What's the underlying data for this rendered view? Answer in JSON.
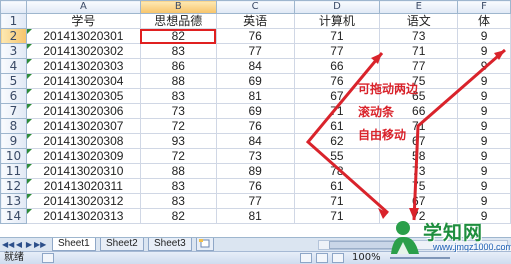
{
  "columns": [
    "A",
    "B",
    "C",
    "D",
    "E",
    "F"
  ],
  "header_row": {
    "row_number": "1",
    "cells": [
      "学号",
      "思想品德",
      "英语",
      "计算机",
      "语文",
      "体"
    ]
  },
  "rows": [
    {
      "num": "2",
      "cells": [
        "201413020301",
        "82",
        "76",
        "71",
        "73",
        "9"
      ]
    },
    {
      "num": "3",
      "cells": [
        "201413020302",
        "83",
        "77",
        "77",
        "71",
        "9"
      ]
    },
    {
      "num": "4",
      "cells": [
        "201413020303",
        "86",
        "84",
        "66",
        "77",
        "9"
      ]
    },
    {
      "num": "5",
      "cells": [
        "201413020304",
        "88",
        "69",
        "76",
        "75",
        "9"
      ]
    },
    {
      "num": "6",
      "cells": [
        "201413020305",
        "83",
        "81",
        "67",
        "65",
        "9"
      ]
    },
    {
      "num": "7",
      "cells": [
        "201413020306",
        "73",
        "69",
        "71",
        "66",
        "9"
      ]
    },
    {
      "num": "8",
      "cells": [
        "201413020307",
        "72",
        "76",
        "61",
        "71",
        "9"
      ]
    },
    {
      "num": "9",
      "cells": [
        "201413020308",
        "93",
        "84",
        "62",
        "67",
        "9"
      ]
    },
    {
      "num": "10",
      "cells": [
        "201413020309",
        "72",
        "73",
        "55",
        "58",
        "9"
      ]
    },
    {
      "num": "11",
      "cells": [
        "201413020310",
        "88",
        "89",
        "78",
        "73",
        "9"
      ]
    },
    {
      "num": "12",
      "cells": [
        "201413020311",
        "83",
        "76",
        "61",
        "75",
        "9"
      ]
    },
    {
      "num": "13",
      "cells": [
        "201413020312",
        "83",
        "77",
        "71",
        "67",
        "9"
      ]
    },
    {
      "num": "14",
      "cells": [
        "201413020313",
        "82",
        "81",
        "71",
        "72",
        "9"
      ]
    }
  ],
  "annotation": {
    "lines": [
      "可拖动两边",
      "滚动条",
      "自由移动"
    ],
    "color": "#d9232b"
  },
  "sheet_tabs": [
    "Sheet1",
    "Sheet2",
    "Sheet3"
  ],
  "status": {
    "ready_label": "就绪",
    "zoom_label": "100%"
  },
  "watermark": {
    "brand": "学知网",
    "url": "www.jmqz1000.com"
  },
  "colors": {
    "grid_line": "#d0d7e5",
    "header_bg": "#dfe8f5",
    "selected_header": "#f7c46a",
    "active_cell_border": "#e02020",
    "watermark_green": "#1e8e3e"
  }
}
